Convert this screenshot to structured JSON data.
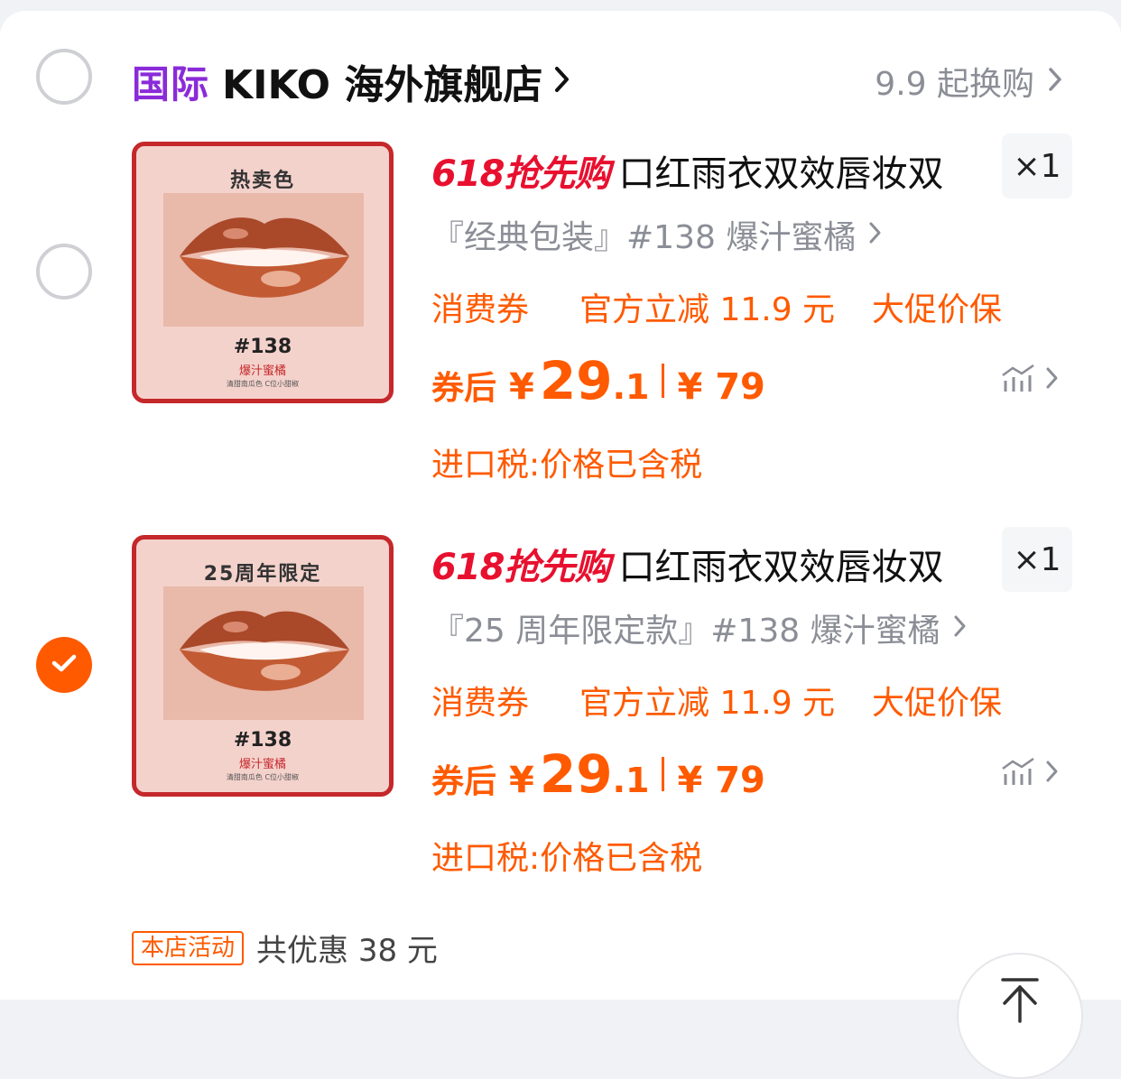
{
  "store": {
    "tag": "国际",
    "name": "KIKO 海外旗舰店",
    "promo_link": "9.9 起换购"
  },
  "items": [
    {
      "checked": false,
      "thumb_title": "热卖色",
      "thumb_code": "#138",
      "thumb_sub": "爆汁蜜橘",
      "thumb_desc": "清甜南瓜色 C位小甜椒",
      "badge": "618抢先购",
      "title": "口红雨衣双效唇妆双",
      "qty": "×1",
      "sku": "『经典包装』#138 爆汁蜜橘",
      "promos": [
        "消费券",
        "官方立减 11.9 元",
        "大促价保"
      ],
      "price_label": "券后",
      "currency": "¥",
      "price_int": "29",
      "price_dec": ".1",
      "orig_price": "¥ 79",
      "tax": "进口税:价格已含税"
    },
    {
      "checked": true,
      "thumb_title": "25周年限定",
      "thumb_code": "#138",
      "thumb_sub": "爆汁蜜橘",
      "thumb_desc": "清甜南瓜色 C位小甜椒",
      "badge": "618抢先购",
      "title": "口红雨衣双效唇妆双",
      "qty": "×1",
      "sku": "『25 周年限定款』#138 爆汁蜜橘",
      "promos": [
        "消费券",
        "官方立减 11.9 元",
        "大促价保"
      ],
      "price_label": "券后",
      "currency": "¥",
      "price_int": "29",
      "price_dec": ".1",
      "orig_price": "¥ 79",
      "tax": "进口税:价格已含税"
    }
  ],
  "activity": {
    "tag": "本店活动",
    "text": "共优惠 38 元"
  },
  "icons": {
    "store_radio": "radio-unchecked-icon",
    "check": "checkmark-icon",
    "chevron": "chevron-right-icon",
    "price_trend": "price-trend-icon",
    "back_top": "back-to-top-icon"
  },
  "colors": {
    "accent": "#ff5a00",
    "badge_red": "#e8102f",
    "store_tag": "#8a2bd9",
    "muted": "#8b8e96"
  }
}
